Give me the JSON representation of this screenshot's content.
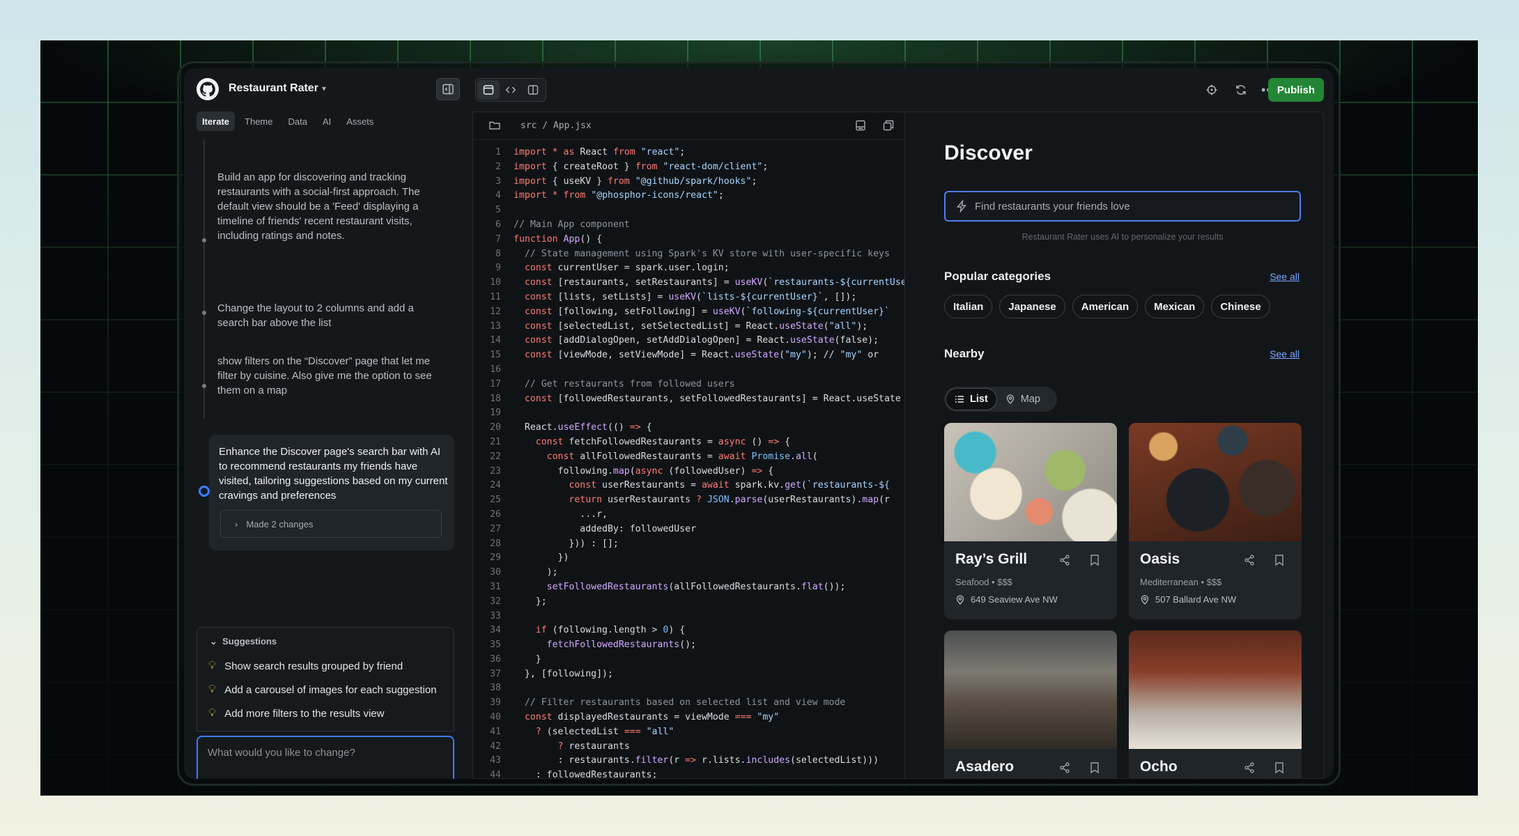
{
  "app": {
    "project_name": "Restaurant Rater",
    "publish_label": "Publish"
  },
  "left": {
    "tabs": [
      "Iterate",
      "Theme",
      "Data",
      "AI",
      "Assets"
    ],
    "messages": [
      "Build an app for discovering and tracking restaurants with a social-first approach. The default view should be a 'Feed' displaying a timeline of friends' recent restaurant visits, including ratings and notes.",
      "Change the layout to 2 columns and add a search bar above the list",
      "show filters on the “Discover” page that let me filter by cuisine. Also give me the option to see them on a map",
      "Enhance the Discover page's search bar with AI to recommend restaurants my friends have visited, tailoring suggestions based on my current cravings and preferences"
    ],
    "made_changes": "Made 2 changes",
    "suggestions_title": "Suggestions",
    "suggestions": [
      "Show search results grouped by friend",
      "Add a carousel of images for each suggestion",
      "Add more filters to the results view"
    ],
    "chat_placeholder": "What would you like to change?"
  },
  "editor": {
    "path": "src / App.jsx",
    "lines": [
      "import * as React from \"react\";",
      "import { createRoot } from \"react-dom/client\";",
      "import { useKV } from \"@github/spark/hooks\";",
      "import * from \"@phosphor-icons/react\";",
      "",
      "// Main App component",
      "function App() {",
      "  // State management using Spark's KV store with user-specific keys",
      "  const currentUser = spark.user.login;",
      "  const [restaurants, setRestaurants] = useKV(`restaurants-${currentUser}`",
      "  const [lists, setLists] = useKV(`lists-${currentUser}`, []);",
      "  const [following, setFollowing] = useKV(`following-${currentUser}`",
      "  const [selectedList, setSelectedList] = React.useState(\"all\");",
      "  const [addDialogOpen, setAddDialogOpen] = React.useState(false);",
      "  const [viewMode, setViewMode] = React.useState(\"my\"); // \"my\" or \"",
      "",
      "  // Get restaurants from followed users",
      "  const [followedRestaurants, setFollowedRestaurants] = React.useState",
      "",
      "  React.useEffect(() => {",
      "    const fetchFollowedRestaurants = async () => {",
      "      const allFollowedRestaurants = await Promise.all(",
      "        following.map(async (followedUser) => {",
      "          const userRestaurants = await spark.kv.get(`restaurants-${",
      "          return userRestaurants ? JSON.parse(userRestaurants).map(r",
      "            ...r,",
      "            addedBy: followedUser",
      "          })) : [];",
      "        })",
      "      );",
      "      setFollowedRestaurants(allFollowedRestaurants.flat());",
      "    };",
      "",
      "    if (following.length > 0) {",
      "      fetchFollowedRestaurants();",
      "    }",
      "  }, [following]);",
      "",
      "  // Filter restaurants based on selected list and view mode",
      "  const displayedRestaurants = viewMode === \"my\"",
      "    ? (selectedList === \"all\"",
      "        ? restaurants",
      "        : restaurants.filter(r => r.lists.includes(selectedList)))",
      "    : followedRestaurants;",
      ""
    ]
  },
  "preview": {
    "title": "Discover",
    "search_placeholder": "Find restaurants your friends love",
    "ai_note": "Restaurant Rater uses AI to personalize your results",
    "popular_title": "Popular categories",
    "nearby_title": "Nearby",
    "see_all": "See all",
    "categories": [
      "Italian",
      "Japanese",
      "American",
      "Mexican",
      "Chinese"
    ],
    "view_list": "List",
    "view_map": "Map",
    "restaurants": [
      {
        "name": "Ray’s Grill",
        "meta": "Seafood • $$$",
        "address": "649 Seaview Ave NW"
      },
      {
        "name": "Oasis",
        "meta": "Mediterranean • $$$",
        "address": "507 Ballard Ave NW"
      },
      {
        "name": "Asadero",
        "meta": "",
        "address": ""
      },
      {
        "name": "Ocho",
        "meta": "",
        "address": ""
      }
    ]
  }
}
